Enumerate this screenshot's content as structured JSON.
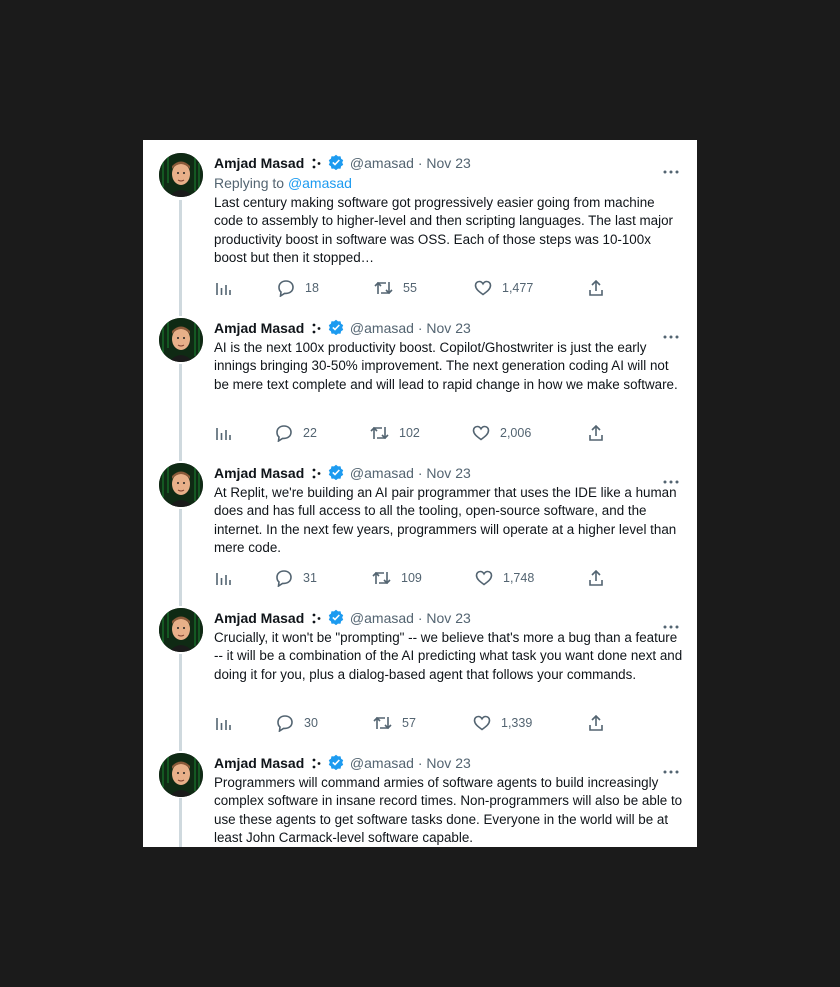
{
  "author": {
    "name": "Amjad Masad",
    "handle": "@amasad",
    "date": "Nov 23",
    "separator": "·"
  },
  "reply_to": {
    "prefix": "Replying to",
    "handle": "@amasad"
  },
  "colors": {
    "accent": "#1d9bf0",
    "muted": "#536471",
    "text": "#0f1419",
    "thread_line": "#cfd9de"
  },
  "icons": [
    "avatar",
    "emoji-icon",
    "verified-badge-icon",
    "more-icon",
    "analytics-icon",
    "reply-icon",
    "retweet-icon",
    "like-icon",
    "share-icon"
  ],
  "tweets": [
    {
      "text": "Last century making software got progressively easier going from machine code to assembly to higher-level and then scripting languages. The last major productivity boost in software was OSS. Each of those steps was 10-100x boost but then it stopped…",
      "replies": "18",
      "retweets": "55",
      "likes": "1,477"
    },
    {
      "text": "AI is the next 100x productivity boost. Copilot/Ghostwriter is just the early innings bringing 30-50% improvement. The next generation coding AI will not be mere text complete and will lead to rapid change in how we make software.",
      "replies": "22",
      "retweets": "102",
      "likes": "2,006"
    },
    {
      "text": "At Replit, we're building an AI pair programmer that uses the IDE like a human does and has full access to all the tooling, open-source software, and the internet. In the next few years, programmers will operate at a higher level than mere code.",
      "replies": "31",
      "retweets": "109",
      "likes": "1,748"
    },
    {
      "text": "Crucially, it won't be \"prompting\" -- we believe that's more a bug than a feature -- it will be a combination of the AI predicting what task you want done next and doing it for you, plus a dialog-based agent that follows your commands.",
      "replies": "30",
      "retweets": "57",
      "likes": "1,339"
    },
    {
      "text": "Programmers will command armies of software agents to build increasingly complex software in insane record times. Non-programmers will also be able to use these agents to get software tasks done. Everyone in the world will be at least John Carmack-level software capable."
    }
  ]
}
